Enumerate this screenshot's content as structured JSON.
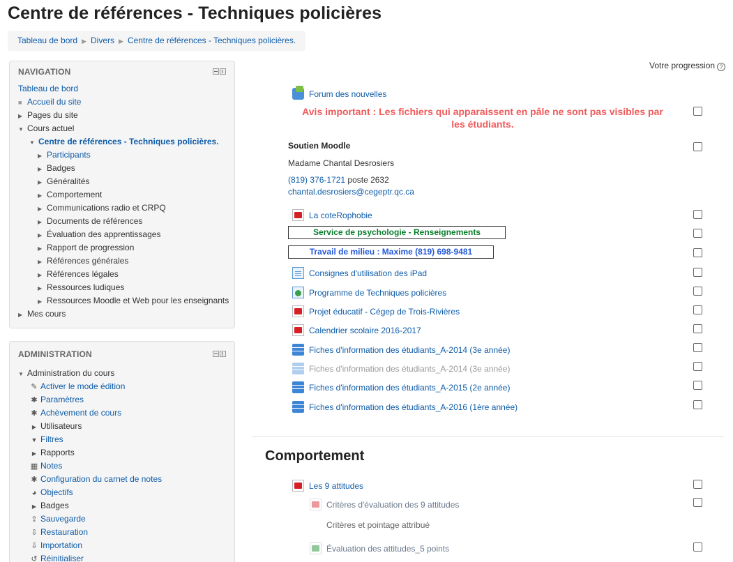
{
  "page": {
    "title": "Centre de références - Techniques policières"
  },
  "breadcrumb": {
    "items": [
      "Tableau de bord",
      "Divers",
      "Centre de références - Techniques policières."
    ],
    "separator": "▶"
  },
  "navigation": {
    "title": "NAVIGATION",
    "dashboard": "Tableau de bord",
    "site_home": "Accueil du site",
    "site_pages": "Pages du site",
    "current_course": "Cours actuel",
    "course_name": "Centre de références - Techniques policières.",
    "course_items": [
      {
        "label": "Participants",
        "link": true,
        "dim": false
      },
      {
        "label": "Badges",
        "link": false,
        "dim": false
      },
      {
        "label": "Généralités",
        "link": false,
        "dim": false
      },
      {
        "label": "Comportement",
        "link": false,
        "dim": false
      },
      {
        "label": "Communications radio et CRPQ",
        "link": false,
        "dim": false
      },
      {
        "label": "Documents de références",
        "link": false,
        "dim": false
      },
      {
        "label": "Évaluation des apprentissages",
        "link": false,
        "dim": true
      },
      {
        "label": "Rapport de progression",
        "link": false,
        "dim": true
      },
      {
        "label": "Références générales",
        "link": false,
        "dim": false
      },
      {
        "label": "Références légales",
        "link": false,
        "dim": false
      },
      {
        "label": "Ressources ludiques",
        "link": false,
        "dim": false
      },
      {
        "label": "Ressources Moodle et Web pour les enseignants",
        "link": false,
        "dim": true
      }
    ],
    "my_courses": "Mes cours"
  },
  "administration": {
    "title": "ADMINISTRATION",
    "course_admin": "Administration du cours",
    "items": [
      {
        "label": "Activer le mode édition",
        "icon": "✎",
        "icon_name": "pencil-icon",
        "kind": "link"
      },
      {
        "label": "Paramètres",
        "icon": "✱",
        "icon_name": "gear-icon",
        "kind": "link"
      },
      {
        "label": "Achèvement de cours",
        "icon": "✱",
        "icon_name": "gear-icon",
        "kind": "link"
      },
      {
        "label": "Utilisateurs",
        "icon": "▶",
        "icon_name": "triangle-right-icon",
        "kind": "branch"
      },
      {
        "label": "Filtres",
        "icon": "▼",
        "icon_name": "filter-icon",
        "kind": "link"
      },
      {
        "label": "Rapports",
        "icon": "▶",
        "icon_name": "triangle-right-icon",
        "kind": "branch"
      },
      {
        "label": "Notes",
        "icon": "▦",
        "icon_name": "table-icon",
        "kind": "link"
      },
      {
        "label": "Configuration du carnet de notes",
        "icon": "✱",
        "icon_name": "gear-icon",
        "kind": "link"
      },
      {
        "label": "Objectifs",
        "icon": "◕",
        "icon_name": "pie-icon",
        "kind": "link"
      },
      {
        "label": "Badges",
        "icon": "▶",
        "icon_name": "triangle-right-icon",
        "kind": "branch"
      },
      {
        "label": "Sauvegarde",
        "icon": "⇪",
        "icon_name": "upload-icon",
        "kind": "link"
      },
      {
        "label": "Restauration",
        "icon": "⇩",
        "icon_name": "download-icon",
        "kind": "link"
      },
      {
        "label": "Importation",
        "icon": "⇩",
        "icon_name": "download-icon",
        "kind": "link"
      },
      {
        "label": "Réinitialiser",
        "icon": "↺",
        "icon_name": "reset-icon",
        "kind": "link"
      }
    ]
  },
  "content": {
    "progress_label": "Votre progression",
    "forum": "Forum des nouvelles",
    "notice_line1": "Avis important : Les fichiers qui apparaissent en pâle ne sont pas visibles par",
    "notice_line2": "les étudiants.",
    "support": {
      "title": "Soutien Moodle",
      "name": "Madame Chantal Desrosiers",
      "phone": "(819) 376-1721",
      "ext": " poste 2632",
      "email": "chantal.desrosiers@cegeptr.qc.ca"
    },
    "cote": "La coteRophobie",
    "psych_box": "Service de psychologie - Renseignements",
    "milieu_box": "Travail de milieu : Maxime (819) 698-9481",
    "ipad": "Consignes d'utilisation des iPad",
    "programme": "Programme de Techniques policières",
    "projet": "Projet éducatif - Cégep de Trois-Rivières",
    "calendrier": "Calendrier scolaire 2016-2017",
    "fiche1": "Fiches d'information des étudiants_A-2014 (3e année)",
    "fiche2": "Fiches d'information des étudiants_A-2014 (3e année)",
    "fiche3": "Fiches d'information des étudiants_A-2015 (2e année)",
    "fiche4": "Fiches d'information des étudiants_A-2016 (1ère année)"
  },
  "comportement": {
    "title": "Comportement",
    "attitudes": "Les 9 attitudes",
    "criteres": "Critères d'évaluation des 9 attitudes",
    "pointage": "Critères et pointage attribué",
    "evaluation": "Évaluation des attitudes_5 points"
  }
}
